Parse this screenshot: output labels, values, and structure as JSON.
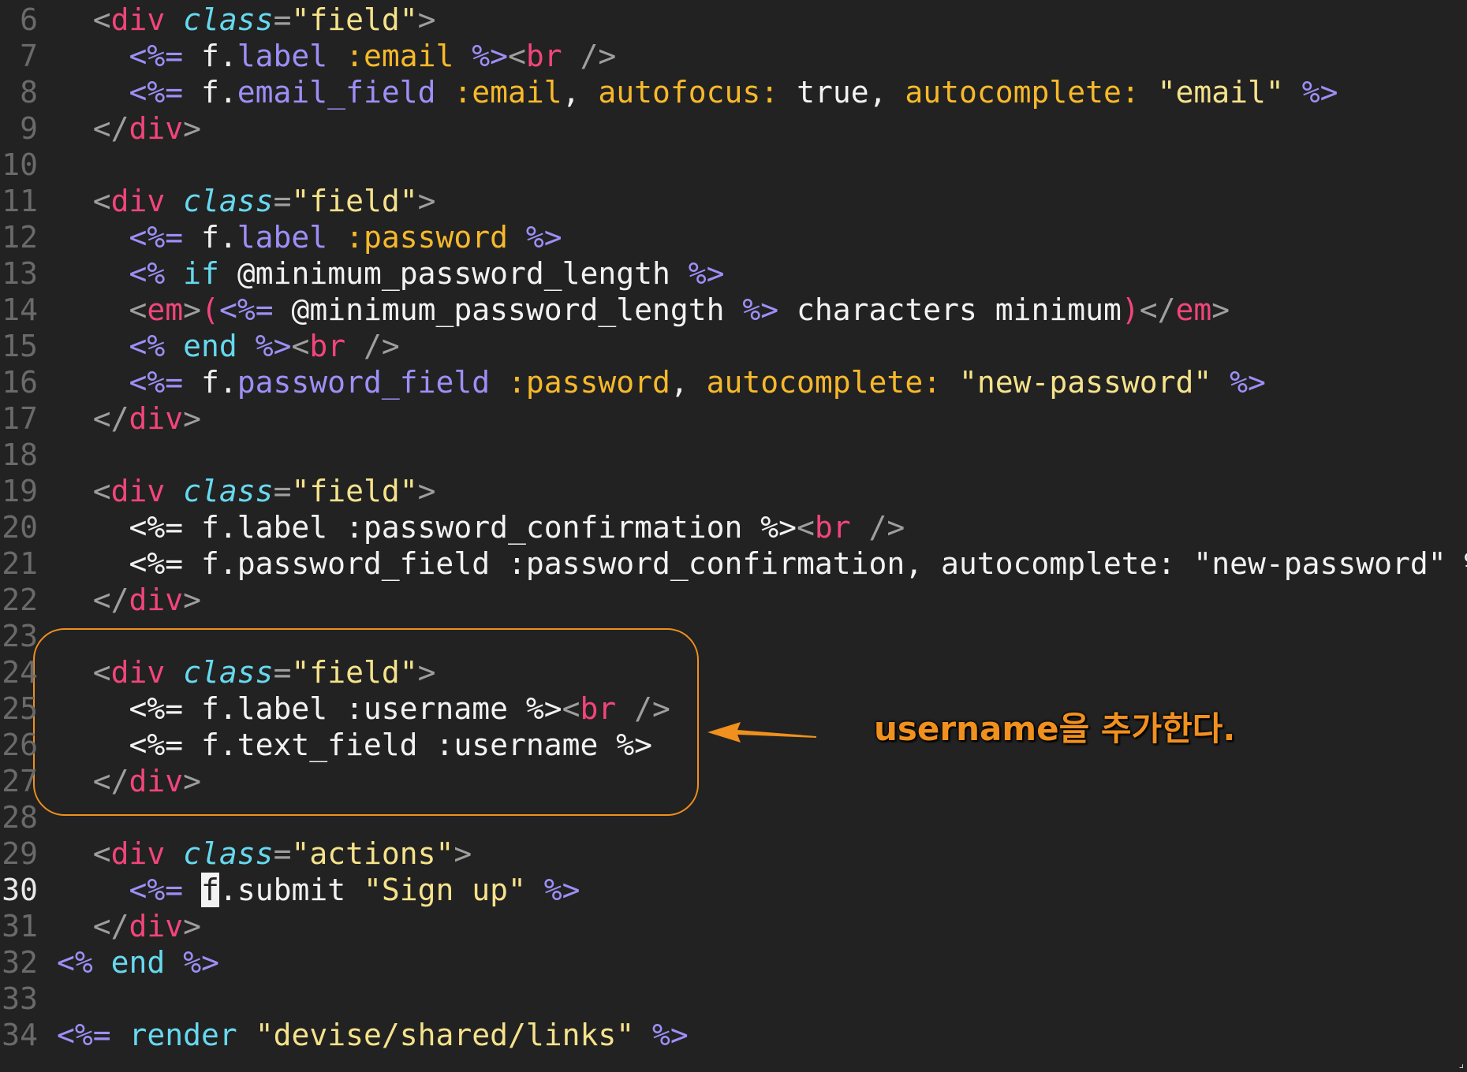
{
  "theme": {
    "background": "#222222",
    "callout_color": "#f0901e",
    "colors": {
      "default": "#f2f2f2",
      "punct": "#9e9e9e",
      "tag": "#f2457b",
      "attr": "#66d9ef",
      "string": "#f5e28a",
      "erb": "#9d8ff7",
      "method": "#9d8ff7",
      "symbol": "#f7b92a",
      "keyword": "#66d9ef"
    }
  },
  "editor": {
    "current_line": "30",
    "lines": [
      {
        "n": "6",
        "tokens": [
          [
            "punct",
            "  <"
          ],
          [
            "tag",
            "div"
          ],
          [
            "default",
            " "
          ],
          [
            "attr",
            "class"
          ],
          [
            "punct",
            "="
          ],
          [
            "string",
            "\"field\""
          ],
          [
            "punct",
            ">"
          ]
        ]
      },
      {
        "n": "7",
        "tokens": [
          [
            "erb",
            "    <%="
          ],
          [
            "default",
            " f."
          ],
          [
            "method",
            "label"
          ],
          [
            "default",
            " "
          ],
          [
            "symbol",
            ":email"
          ],
          [
            "default",
            " "
          ],
          [
            "erb",
            "%>"
          ],
          [
            "punct",
            "<"
          ],
          [
            "tag",
            "br"
          ],
          [
            "punct",
            " />"
          ]
        ]
      },
      {
        "n": "8",
        "tokens": [
          [
            "erb",
            "    <%="
          ],
          [
            "default",
            " f."
          ],
          [
            "method",
            "email_field"
          ],
          [
            "default",
            " "
          ],
          [
            "symbol",
            ":email"
          ],
          [
            "default",
            ", "
          ],
          [
            "symbol",
            "autofocus:"
          ],
          [
            "default",
            " true, "
          ],
          [
            "symbol",
            "autocomplete:"
          ],
          [
            "default",
            " "
          ],
          [
            "string",
            "\"email\""
          ],
          [
            "default",
            " "
          ],
          [
            "erb",
            "%>"
          ]
        ]
      },
      {
        "n": "9",
        "tokens": [
          [
            "punct",
            "  </"
          ],
          [
            "tag",
            "div"
          ],
          [
            "punct",
            ">"
          ]
        ]
      },
      {
        "n": "10",
        "tokens": []
      },
      {
        "n": "11",
        "tokens": [
          [
            "punct",
            "  <"
          ],
          [
            "tag",
            "div"
          ],
          [
            "default",
            " "
          ],
          [
            "attr",
            "class"
          ],
          [
            "punct",
            "="
          ],
          [
            "string",
            "\"field\""
          ],
          [
            "punct",
            ">"
          ]
        ]
      },
      {
        "n": "12",
        "tokens": [
          [
            "erb",
            "    <%="
          ],
          [
            "default",
            " f."
          ],
          [
            "method",
            "label"
          ],
          [
            "default",
            " "
          ],
          [
            "symbol",
            ":password"
          ],
          [
            "default",
            " "
          ],
          [
            "erb",
            "%>"
          ]
        ]
      },
      {
        "n": "13",
        "tokens": [
          [
            "erb",
            "    <%"
          ],
          [
            "default",
            " "
          ],
          [
            "keyword",
            "if"
          ],
          [
            "default",
            " @minimum_password_length "
          ],
          [
            "erb",
            "%>"
          ]
        ]
      },
      {
        "n": "14",
        "tokens": [
          [
            "punct",
            "    <"
          ],
          [
            "tag",
            "em"
          ],
          [
            "punct",
            ">"
          ],
          [
            "tag",
            "("
          ],
          [
            "erb",
            "<%="
          ],
          [
            "default",
            " @minimum_password_length "
          ],
          [
            "erb",
            "%>"
          ],
          [
            "default",
            " characters minimum"
          ],
          [
            "tag",
            ")"
          ],
          [
            "punct",
            "</"
          ],
          [
            "tag",
            "em"
          ],
          [
            "punct",
            ">"
          ]
        ]
      },
      {
        "n": "15",
        "tokens": [
          [
            "erb",
            "    <%"
          ],
          [
            "default",
            " "
          ],
          [
            "keyword",
            "end"
          ],
          [
            "default",
            " "
          ],
          [
            "erb",
            "%>"
          ],
          [
            "punct",
            "<"
          ],
          [
            "tag",
            "br"
          ],
          [
            "punct",
            " />"
          ]
        ]
      },
      {
        "n": "16",
        "tokens": [
          [
            "erb",
            "    <%="
          ],
          [
            "default",
            " f."
          ],
          [
            "method",
            "password_field"
          ],
          [
            "default",
            " "
          ],
          [
            "symbol",
            ":password"
          ],
          [
            "default",
            ", "
          ],
          [
            "symbol",
            "autocomplete:"
          ],
          [
            "default",
            " "
          ],
          [
            "string",
            "\"new-password\""
          ],
          [
            "default",
            " "
          ],
          [
            "erb",
            "%>"
          ]
        ]
      },
      {
        "n": "17",
        "tokens": [
          [
            "punct",
            "  </"
          ],
          [
            "tag",
            "div"
          ],
          [
            "punct",
            ">"
          ]
        ]
      },
      {
        "n": "18",
        "tokens": []
      },
      {
        "n": "19",
        "tokens": [
          [
            "punct",
            "  <"
          ],
          [
            "tag",
            "div"
          ],
          [
            "default",
            " "
          ],
          [
            "attr",
            "class"
          ],
          [
            "punct",
            "="
          ],
          [
            "string",
            "\"field\""
          ],
          [
            "punct",
            ">"
          ]
        ]
      },
      {
        "n": "20",
        "tokens": [
          [
            "default",
            "    <%= f.label :password_confirmation %>"
          ],
          [
            "punct",
            "<"
          ],
          [
            "tag",
            "br"
          ],
          [
            "punct",
            " />"
          ]
        ]
      },
      {
        "n": "21",
        "tokens": [
          [
            "default",
            "    <%= f.password_field :password_confirmation, autocomplete: \"new-password\" %>"
          ]
        ]
      },
      {
        "n": "22",
        "tokens": [
          [
            "punct",
            "  </"
          ],
          [
            "tag",
            "div"
          ],
          [
            "punct",
            ">"
          ]
        ]
      },
      {
        "n": "23",
        "tokens": []
      },
      {
        "n": "24",
        "tokens": [
          [
            "punct",
            "  <"
          ],
          [
            "tag",
            "div"
          ],
          [
            "default",
            " "
          ],
          [
            "attr",
            "class"
          ],
          [
            "punct",
            "="
          ],
          [
            "string",
            "\"field\""
          ],
          [
            "punct",
            ">"
          ]
        ]
      },
      {
        "n": "25",
        "tokens": [
          [
            "default",
            "    <%= f.label :username %>"
          ],
          [
            "punct",
            "<"
          ],
          [
            "tag",
            "br"
          ],
          [
            "punct",
            " />"
          ]
        ]
      },
      {
        "n": "26",
        "tokens": [
          [
            "default",
            "    <%= f.text_field :username %>"
          ]
        ]
      },
      {
        "n": "27",
        "tokens": [
          [
            "punct",
            "  </"
          ],
          [
            "tag",
            "div"
          ],
          [
            "punct",
            ">"
          ]
        ]
      },
      {
        "n": "28",
        "tokens": []
      },
      {
        "n": "29",
        "tokens": [
          [
            "punct",
            "  <"
          ],
          [
            "tag",
            "div"
          ],
          [
            "default",
            " "
          ],
          [
            "attr",
            "class"
          ],
          [
            "punct",
            "="
          ],
          [
            "string",
            "\"actions\""
          ],
          [
            "punct",
            ">"
          ]
        ]
      },
      {
        "n": "30",
        "tokens": [
          [
            "erb",
            "    <%="
          ],
          [
            "default",
            " "
          ],
          [
            "cursor",
            "f"
          ],
          [
            "default",
            ".submit "
          ],
          [
            "string",
            "\"Sign up\""
          ],
          [
            "default",
            " "
          ],
          [
            "erb",
            "%>"
          ]
        ]
      },
      {
        "n": "31",
        "tokens": [
          [
            "punct",
            "  </"
          ],
          [
            "tag",
            "div"
          ],
          [
            "punct",
            ">"
          ]
        ]
      },
      {
        "n": "32",
        "tokens": [
          [
            "erb",
            "<%"
          ],
          [
            "default",
            " "
          ],
          [
            "keyword",
            "end"
          ],
          [
            "default",
            " "
          ],
          [
            "erb",
            "%>"
          ]
        ]
      },
      {
        "n": "33",
        "tokens": []
      },
      {
        "n": "34",
        "tokens": [
          [
            "erb",
            "<%="
          ],
          [
            "default",
            " "
          ],
          [
            "keyword",
            "render"
          ],
          [
            "default",
            " "
          ],
          [
            "string",
            "\"devise/shared/links\""
          ],
          [
            "default",
            " "
          ],
          [
            "erb",
            "%>"
          ]
        ]
      }
    ]
  },
  "annotation": {
    "text": "username을 추가한다.",
    "icon": "arrow-left-icon"
  }
}
